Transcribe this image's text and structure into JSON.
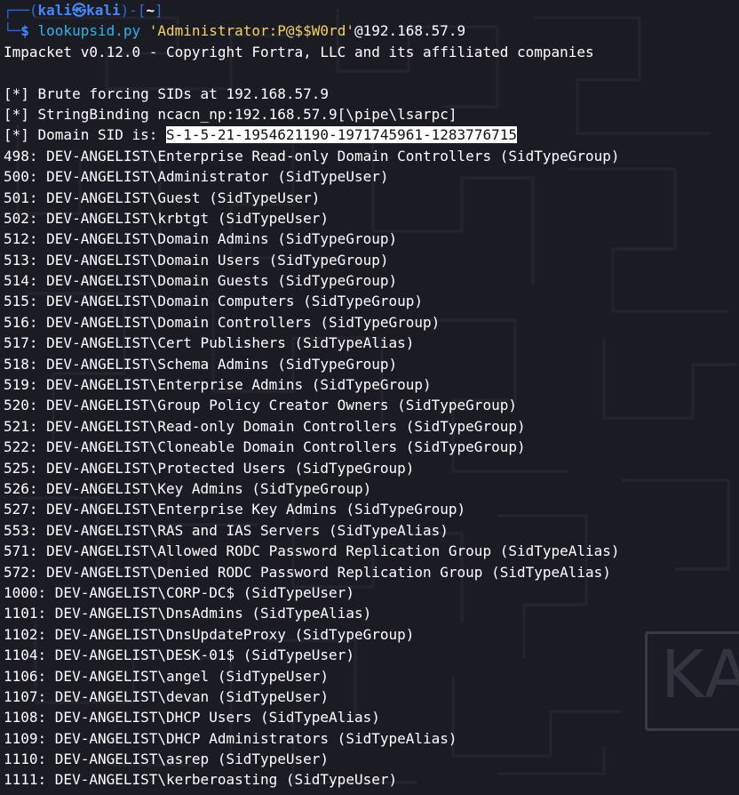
{
  "prompt": {
    "corner_top": "┌──(",
    "user_host": "kali㉿kali",
    "close_paren": ")-[",
    "cwd": "~",
    "close_bracket": "]",
    "corner_bottom": "└─",
    "dollar": "$ ",
    "command": "lookupsid.py",
    "space": " ",
    "argument": "'Administrator:P@$$W0rd'",
    "target": "@192.168.57.9"
  },
  "banner": "Impacket v0.12.0 - Copyright Fortra, LLC and its affiliated companies",
  "info": {
    "brute": "[*] Brute forcing SIDs at 192.168.57.9",
    "binding": "[*] StringBinding ncacn_np:192.168.57.9[\\pipe\\lsarpc]",
    "domain_sid_label": "[*] Domain SID is: ",
    "domain_sid_value": "S-1-5-21-1954621190-1971745961-1283776715"
  },
  "entries": [
    "498: DEV-ANGELIST\\Enterprise Read-only Domain Controllers (SidTypeGroup)",
    "500: DEV-ANGELIST\\Administrator (SidTypeUser)",
    "501: DEV-ANGELIST\\Guest (SidTypeUser)",
    "502: DEV-ANGELIST\\krbtgt (SidTypeUser)",
    "512: DEV-ANGELIST\\Domain Admins (SidTypeGroup)",
    "513: DEV-ANGELIST\\Domain Users (SidTypeGroup)",
    "514: DEV-ANGELIST\\Domain Guests (SidTypeGroup)",
    "515: DEV-ANGELIST\\Domain Computers (SidTypeGroup)",
    "516: DEV-ANGELIST\\Domain Controllers (SidTypeGroup)",
    "517: DEV-ANGELIST\\Cert Publishers (SidTypeAlias)",
    "518: DEV-ANGELIST\\Schema Admins (SidTypeGroup)",
    "519: DEV-ANGELIST\\Enterprise Admins (SidTypeGroup)",
    "520: DEV-ANGELIST\\Group Policy Creator Owners (SidTypeGroup)",
    "521: DEV-ANGELIST\\Read-only Domain Controllers (SidTypeGroup)",
    "522: DEV-ANGELIST\\Cloneable Domain Controllers (SidTypeGroup)",
    "525: DEV-ANGELIST\\Protected Users (SidTypeGroup)",
    "526: DEV-ANGELIST\\Key Admins (SidTypeGroup)",
    "527: DEV-ANGELIST\\Enterprise Key Admins (SidTypeGroup)",
    "553: DEV-ANGELIST\\RAS and IAS Servers (SidTypeAlias)",
    "571: DEV-ANGELIST\\Allowed RODC Password Replication Group (SidTypeAlias)",
    "572: DEV-ANGELIST\\Denied RODC Password Replication Group (SidTypeAlias)",
    "1000: DEV-ANGELIST\\CORP-DC$ (SidTypeUser)",
    "1101: DEV-ANGELIST\\DnsAdmins (SidTypeAlias)",
    "1102: DEV-ANGELIST\\DnsUpdateProxy (SidTypeGroup)",
    "1104: DEV-ANGELIST\\DESK-01$ (SidTypeUser)",
    "1106: DEV-ANGELIST\\angel (SidTypeUser)",
    "1107: DEV-ANGELIST\\devan (SidTypeUser)",
    "1108: DEV-ANGELIST\\DHCP Users (SidTypeAlias)",
    "1109: DEV-ANGELIST\\DHCP Administrators (SidTypeAlias)",
    "1110: DEV-ANGELIST\\asrep (SidTypeUser)",
    "1111: DEV-ANGELIST\\kerberoasting (SidTypeUser)"
  ],
  "watermark": "KALI",
  "colors": {
    "background": "#1b1b24",
    "prompt_blue": "#3f8cff",
    "command_cyan": "#29b7e8",
    "argument_yellow": "#f4d35e",
    "text": "#ffffff"
  }
}
